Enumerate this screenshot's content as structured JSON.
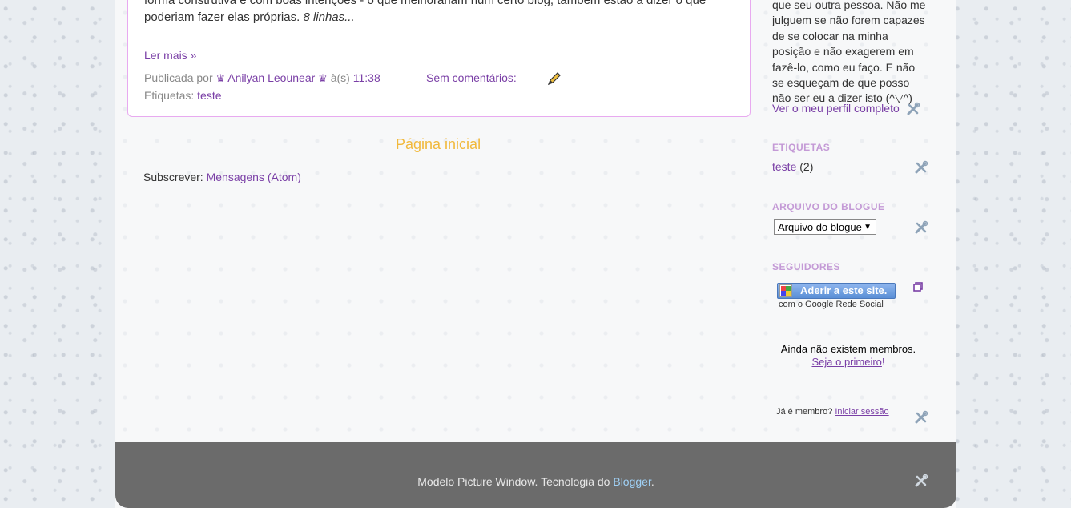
{
  "post": {
    "text_line1": "forma construtiva e com boas intenções - o que melhorariam num certo blog, também estão a dizer o que",
    "text_line2": "poderiam fazer elas próprias.",
    "excerpt_count": "8 linhas...",
    "read_more": "Ler mais »",
    "published_by": "Publicada por",
    "author": "Anilyan Leounear",
    "at": "à(s)",
    "time": "11:38",
    "comments": "Sem comentários:",
    "labels_prefix": "Etiquetas:",
    "label": "teste"
  },
  "main": {
    "home_link": "Página inicial",
    "subscribe_prefix": "Subscrever:",
    "subscribe_link": "Mensagens (Atom)"
  },
  "sidebar": {
    "about_lines": [
      "que seu outra pessoa. Não me",
      "julguem se não forem capazes",
      "de se colocar na minha",
      "posição e não exagerem em",
      "fazê-lo, como eu faço. E não",
      "se esqueçam de que posso",
      "não ser eu a dizer isto (^▽^)"
    ],
    "profile_link": "Ver o meu perfil completo",
    "labels_title": "ETIQUETAS",
    "label_name": "teste",
    "label_count": "(2)",
    "archive_title": "ARQUIVO DO BLOGUE",
    "archive_select": "Arquivo do blogue",
    "followers_title": "SEGUIDORES",
    "join_button": "Aderir a este site.",
    "join_sub": "com o Google Rede Social",
    "no_members": "Ainda não existem membros.",
    "be_first": "Seja o primeiro",
    "be_first_suffix": "!",
    "already_member": "Já é membro?",
    "sign_in": "Iniciar sessão"
  },
  "footer": {
    "credit_prefix": "Modelo Picture Window. Tecnologia do",
    "blogger": "Blogger",
    "credit_suffix": "."
  }
}
